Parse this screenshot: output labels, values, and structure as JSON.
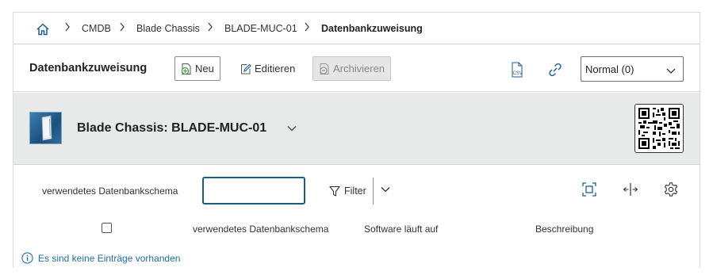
{
  "breadcrumb": {
    "home_icon": "home-icon",
    "items": [
      "CMDB",
      "Blade Chassis",
      "BLADE-MUC-01"
    ],
    "current": "Datenbankzuweisung"
  },
  "toolbar": {
    "title": "Datenbankzuweisung",
    "new_label": "Neu",
    "edit_label": "Editieren",
    "archive_label": "Archivieren",
    "csv_icon": "csv-export-icon",
    "link_icon": "link-icon",
    "view_select_value": "Normal (0)"
  },
  "object": {
    "title": "Blade Chassis: BLADE-MUC-01",
    "image_icon": "blade-chassis-image",
    "qr_icon": "qr-code"
  },
  "filter": {
    "label": "verwendetes Datenbankschema",
    "input_value": "",
    "button_label": "Filter"
  },
  "table": {
    "columns": [
      "verwendetes Datenbankschema",
      "Software läuft auf",
      "Beschreibung"
    ]
  },
  "empty_message": "Es sind keine Einträge vorhanden",
  "colors": {
    "accent": "#175d84",
    "info": "#1d6fa5",
    "header_bg": "#e8e9e9",
    "new_icon": "#3aa13a"
  }
}
